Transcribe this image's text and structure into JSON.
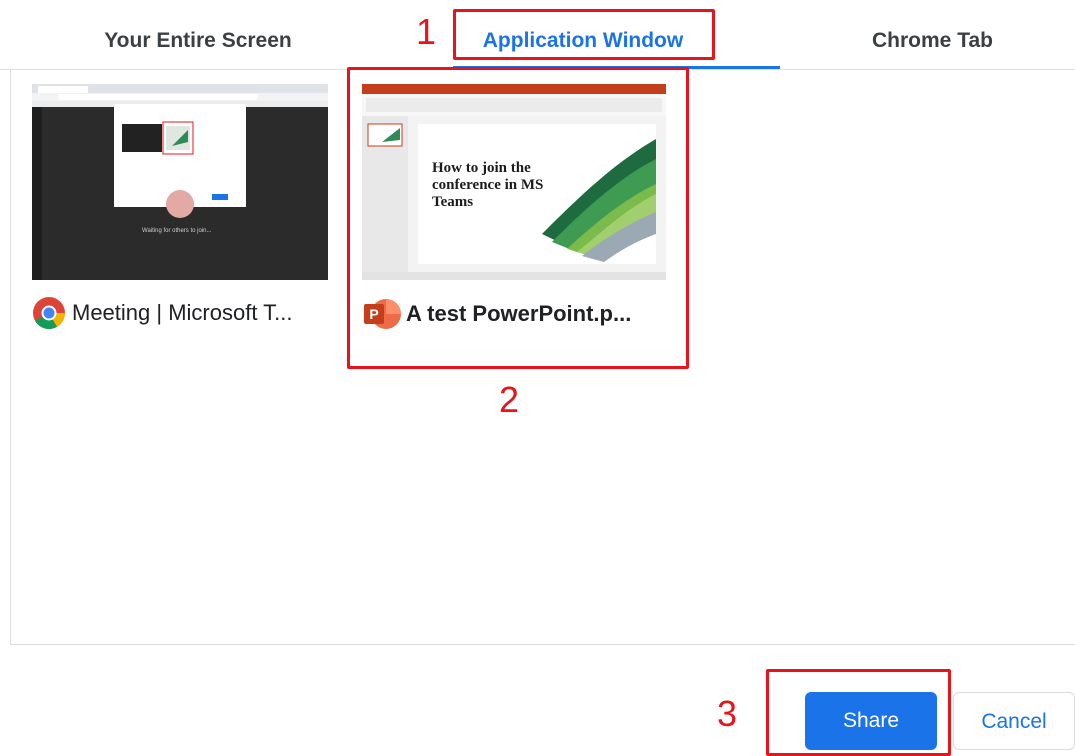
{
  "tabs": [
    {
      "label": "Your Entire Screen",
      "active": false
    },
    {
      "label": "Application Window",
      "active": true
    },
    {
      "label": "Chrome Tab",
      "active": false
    }
  ],
  "cards": [
    {
      "title": "Meeting | Microsoft T...",
      "icon": "chrome-icon",
      "thumb_caption": "Waiting for others to join..."
    },
    {
      "title": "A test PowerPoint.p...",
      "icon": "powerpoint-icon",
      "slide_title": "How to join the conference in MS Teams",
      "selected": true
    }
  ],
  "callouts": [
    "1",
    "2",
    "3"
  ],
  "buttons": {
    "share": "Share",
    "cancel": "Cancel"
  },
  "colors": {
    "accent": "#1a73e8",
    "callout": "#e8141b",
    "ppt": "#d24726"
  }
}
